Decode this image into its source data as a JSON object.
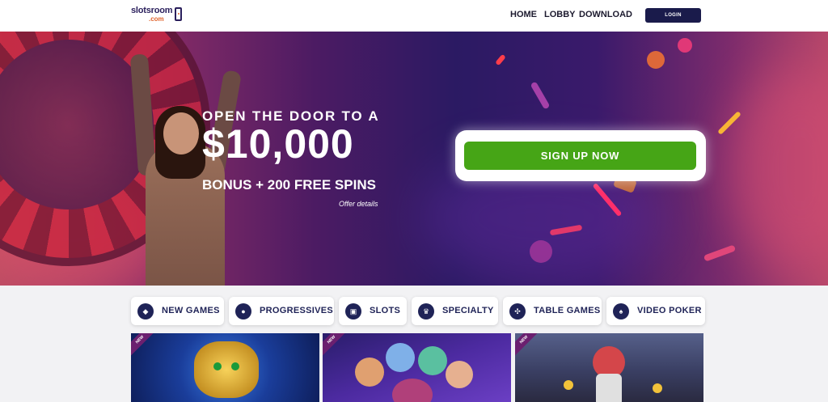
{
  "header": {
    "logo_name": "slotsroom",
    "logo_tld": ".com",
    "nav": [
      "HOME",
      "LOBBY",
      "DOWNLOAD"
    ],
    "login_label": "LOGIN"
  },
  "hero": {
    "line1": "OPEN THE DOOR TO A",
    "amount": "$10,000",
    "bonus": "BONUS + 200 FREE SPINS",
    "offer_link": "Offer details",
    "signup_label": "SIGN UP NOW"
  },
  "categories": [
    {
      "label": "NEW GAMES",
      "icon": "diamond-icon"
    },
    {
      "label": "PROGRESSIVES",
      "icon": "coins-icon"
    },
    {
      "label": "SLOTS",
      "icon": "slot-machine-icon"
    },
    {
      "label": "SPECIALTY",
      "icon": "crown-icon"
    },
    {
      "label": "TABLE GAMES",
      "icon": "dice-icon"
    },
    {
      "label": "VIDEO POKER",
      "icon": "cards-icon"
    }
  ],
  "games": [
    {
      "badge": "NEW"
    },
    {
      "badge": "NEW"
    },
    {
      "badge": "NEW"
    }
  ],
  "colors": {
    "brand_navy": "#1f2357",
    "signup_green": "#46a516",
    "login_bg": "#1a1b4b"
  }
}
